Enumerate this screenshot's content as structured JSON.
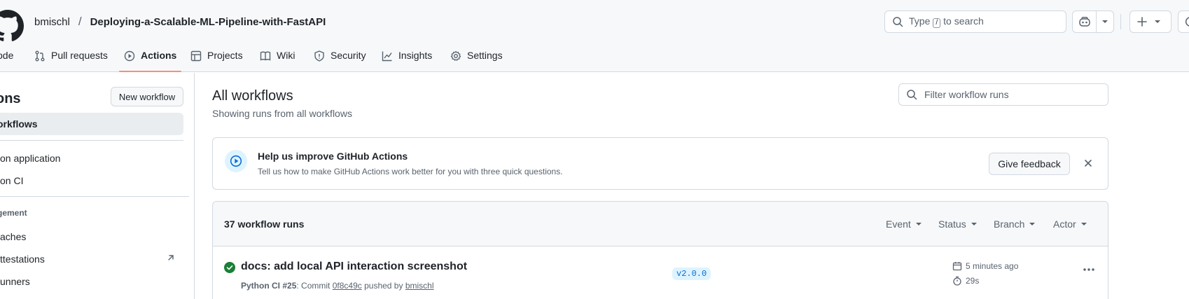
{
  "header": {
    "owner": "bmischl",
    "separator": "/",
    "repo": "Deploying-a-Scalable-ML-Pipeline-with-FastAPI",
    "search_prefix": "Type",
    "search_key": "/",
    "search_suffix": "to search"
  },
  "tabs": [
    {
      "label": "ode",
      "icon": "code-icon"
    },
    {
      "label": "Pull requests",
      "icon": "git-pull-request-icon"
    },
    {
      "label": "Actions",
      "icon": "play-icon",
      "active": true
    },
    {
      "label": "Projects",
      "icon": "table-icon"
    },
    {
      "label": "Wiki",
      "icon": "book-icon"
    },
    {
      "label": "Security",
      "icon": "shield-icon"
    },
    {
      "label": "Insights",
      "icon": "graph-icon"
    },
    {
      "label": "Settings",
      "icon": "gear-icon"
    }
  ],
  "sidebar": {
    "title": "ons",
    "new_workflow": "New workflow",
    "all_workflows": "orkflows",
    "workflows": [
      "on application",
      "on CI"
    ],
    "management_heading": "gement",
    "management": [
      "aches",
      "ttestations",
      "unners"
    ]
  },
  "main": {
    "title": "All workflows",
    "subtitle": "Showing runs from all workflows",
    "filter_placeholder": "Filter workflow runs"
  },
  "feedback": {
    "title": "Help us improve GitHub Actions",
    "description": "Tell us how to make GitHub Actions work better for you with three quick questions.",
    "button": "Give feedback"
  },
  "runs": {
    "count_label": "37 workflow runs",
    "filters": [
      "Event",
      "Status",
      "Branch",
      "Actor"
    ],
    "items": [
      {
        "title": "docs: add local API interaction screenshot",
        "workflow": "Python CI",
        "run_number": "#25",
        "commit_prefix": ": Commit",
        "commit": "0f8c49c",
        "pushed_by_text": "pushed by",
        "actor": "bmischl",
        "branch": "v2.0.0",
        "time_ago": "5 minutes ago",
        "duration": "29s",
        "status": "success"
      }
    ]
  },
  "colors": {
    "accent": "#fd8c73",
    "success": "#1a7f37",
    "link": "#0969da"
  }
}
